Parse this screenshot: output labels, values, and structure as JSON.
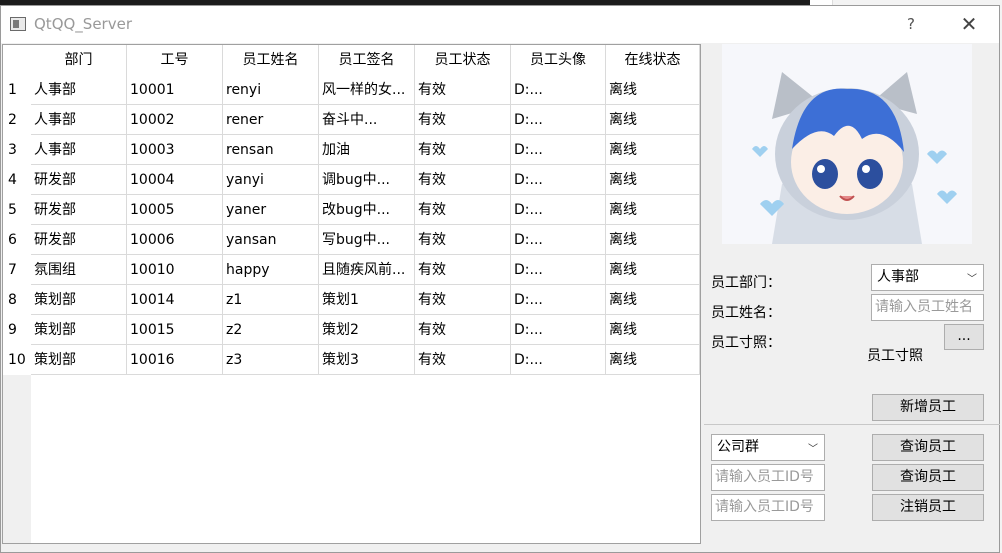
{
  "window": {
    "title": "QtQQ_Server",
    "help_label": "?",
    "close_label": "✕"
  },
  "table": {
    "headers": [
      "部门",
      "工号",
      "员工姓名",
      "员工签名",
      "员工状态",
      "员工头像",
      "在线状态"
    ],
    "rows": [
      {
        "num": "1",
        "cells": [
          "人事部",
          "10001",
          "renyi",
          "风一样的女...",
          "有效",
          "D:...",
          "离线"
        ]
      },
      {
        "num": "2",
        "cells": [
          "人事部",
          "10002",
          "rener",
          "奋斗中...",
          "有效",
          "D:...",
          "离线"
        ]
      },
      {
        "num": "3",
        "cells": [
          "人事部",
          "10003",
          "rensan",
          "加油",
          "有效",
          "D:...",
          "离线"
        ]
      },
      {
        "num": "4",
        "cells": [
          "研发部",
          "10004",
          "yanyi",
          "调bug中...",
          "有效",
          "D:...",
          "离线"
        ]
      },
      {
        "num": "5",
        "cells": [
          "研发部",
          "10005",
          "yaner",
          "改bug中...",
          "有效",
          "D:...",
          "离线"
        ]
      },
      {
        "num": "6",
        "cells": [
          "研发部",
          "10006",
          "yansan",
          "写bug中...",
          "有效",
          "D:...",
          "离线"
        ]
      },
      {
        "num": "7",
        "cells": [
          "氛围组",
          "10010",
          "happy",
          "且随疾风前...",
          "有效",
          "D:...",
          "离线"
        ]
      },
      {
        "num": "8",
        "cells": [
          "策划部",
          "10014",
          "z1",
          "策划1",
          "有效",
          "D:...",
          "离线"
        ]
      },
      {
        "num": "9",
        "cells": [
          "策划部",
          "10015",
          "z2",
          "策划2",
          "有效",
          "D:...",
          "离线"
        ]
      },
      {
        "num": "10",
        "cells": [
          "策划部",
          "10016",
          "z3",
          "策划3",
          "有效",
          "D:...",
          "离线"
        ]
      }
    ]
  },
  "form": {
    "dept_label": "员工部门：",
    "dept_value": "人事部",
    "name_label": "员工姓名：",
    "name_placeholder": "请输入员工姓名",
    "photo_label": "员工寸照：",
    "photo_button": "...",
    "photo_text": "员工寸照",
    "add_button": "新增员工"
  },
  "query": {
    "group_value": "公司群",
    "query_button_1": "查询员工",
    "id_placeholder_1": "请输入员工ID号",
    "query_button_2": "查询员工",
    "id_placeholder_2": "请输入员工ID号",
    "logout_button": "注销员工"
  },
  "icons": {
    "dropdown": "chevron-down-icon",
    "app": "window-icon",
    "avatar": "anime-avatar-image"
  },
  "colors": {
    "title_text": "#999999",
    "button_bg": "#e1e1e1",
    "panel_bg": "#f0f0f0"
  }
}
